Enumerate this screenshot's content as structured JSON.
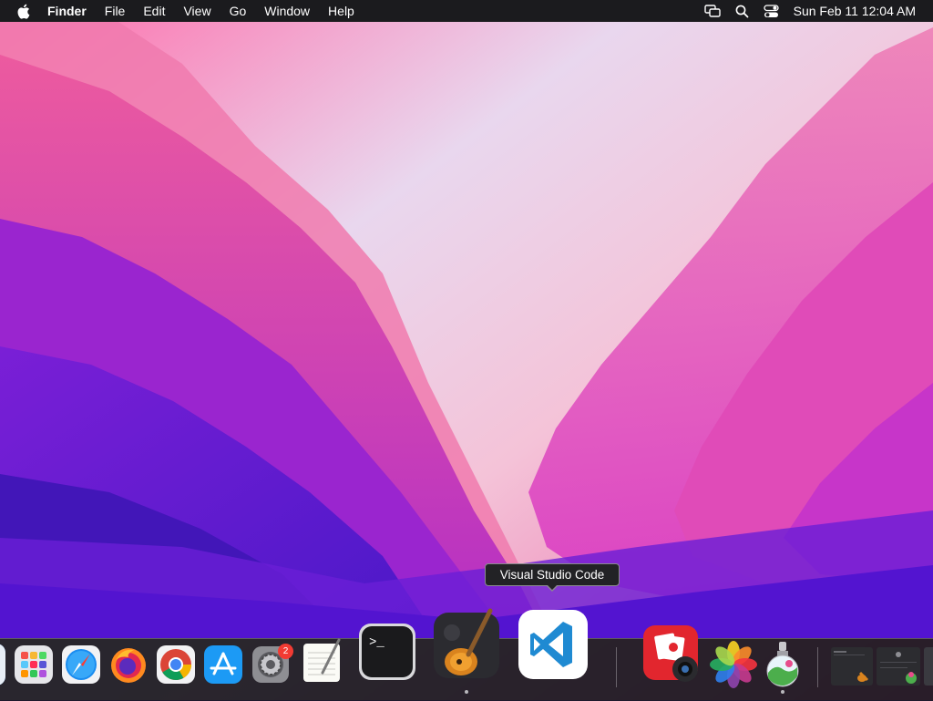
{
  "menubar": {
    "app_name": "Finder",
    "menus": [
      "File",
      "Edit",
      "View",
      "Go",
      "Window",
      "Help"
    ],
    "clock": "Sun Feb 11  12:04 AM",
    "status_icons": [
      "screen-mirroring-icon",
      "spotlight-search-icon",
      "control-center-icon"
    ]
  },
  "tooltip": {
    "text": "Visual Studio Code"
  },
  "dock": {
    "apps": [
      {
        "name": "finder-icon"
      },
      {
        "name": "launchpad-icon"
      },
      {
        "name": "safari-icon"
      },
      {
        "name": "firefox-icon"
      },
      {
        "name": "chrome-icon"
      },
      {
        "name": "app-store-icon"
      },
      {
        "name": "system-settings-icon",
        "badge": "2"
      },
      {
        "name": "textedit-icon"
      },
      {
        "name": "terminal-icon"
      },
      {
        "name": "garageband-icon",
        "running": true
      },
      {
        "name": "visual-studio-code-icon",
        "hovered": true
      },
      {
        "name": "photo-booth-icon"
      },
      {
        "name": "photos-icon"
      },
      {
        "name": "preview-icon",
        "running": true
      }
    ]
  },
  "colors": {
    "menubar": "#1b1b1e",
    "tooltip_bg": "#222225",
    "vscode_blue": "#1f8ad2",
    "badge_red": "#f23b33"
  }
}
